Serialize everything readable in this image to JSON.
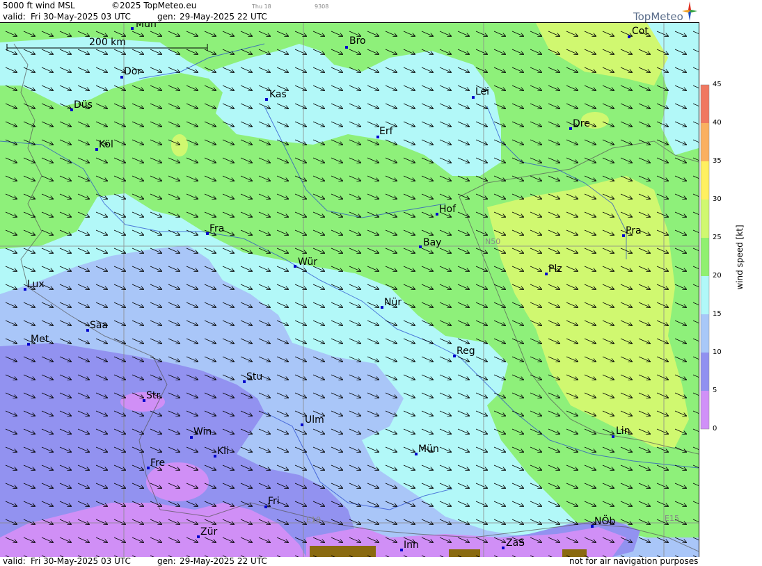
{
  "header": {
    "product": "5000 ft wind MSL",
    "copyright": "©2025 TopMeteo.eu",
    "day_tag": "Thu 18",
    "code_tag": "9308",
    "valid_label": "valid:",
    "valid_date": "Fri  30-May-2025  03 UTC",
    "gen_label": "gen:",
    "gen_date": "29-May-2025 22 UTC",
    "logo": "TopMeteo"
  },
  "footer": {
    "valid_label": "valid:",
    "valid_date": "Fri  30-May-2025  03 UTC",
    "gen_label": "gen:",
    "gen_date": "29-May-2025 22 UTC",
    "disclaimer": "not for air navigation purposes"
  },
  "map": {
    "scale_label": "200 km",
    "grid_labels": {
      "lat": "N50",
      "lon1": "E10",
      "lon2": "E15"
    },
    "cities": [
      {
        "name": "Mün",
        "id": "munster"
      },
      {
        "name": "Bro"
      },
      {
        "name": "Cot"
      },
      {
        "name": "Dor"
      },
      {
        "name": "Kas"
      },
      {
        "name": "Lei"
      },
      {
        "name": "Düs"
      },
      {
        "name": "Erf"
      },
      {
        "name": "Dre"
      },
      {
        "name": "Köl"
      },
      {
        "name": "Hof"
      },
      {
        "name": "Fra"
      },
      {
        "name": "Pra"
      },
      {
        "name": "Bay"
      },
      {
        "name": "Würz",
        "display": "Wür"
      },
      {
        "name": "Plz"
      },
      {
        "name": "Lux"
      },
      {
        "name": "Nür"
      },
      {
        "name": "Saa"
      },
      {
        "name": "Met"
      },
      {
        "name": "Reg"
      },
      {
        "name": "Stu"
      },
      {
        "name": "Str"
      },
      {
        "name": "Ulm"
      },
      {
        "name": "Win"
      },
      {
        "name": "Kli"
      },
      {
        "name": "Lin"
      },
      {
        "name": "Mün2",
        "display": "Mün"
      },
      {
        "name": "Fre"
      },
      {
        "name": "Fri"
      },
      {
        "name": "NÖb"
      },
      {
        "name": "Zür"
      },
      {
        "name": "Inn"
      },
      {
        "name": "ZaS"
      }
    ]
  },
  "legend": {
    "title": "wind speed [kt]",
    "ticks": [
      "45",
      "40",
      "35",
      "30",
      "25",
      "20",
      "15",
      "10",
      "5",
      "0"
    ],
    "colors": {
      "c40_45": "#f07860",
      "c35_40": "#fab060",
      "c30_35": "#fff060",
      "c25_30": "#d0f870",
      "c20_25": "#90f070",
      "c15_20": "#b0f8f8",
      "c10_15": "#a8c8f8",
      "c5_10": "#9090f0",
      "c0_5": "#d090f8"
    }
  }
}
